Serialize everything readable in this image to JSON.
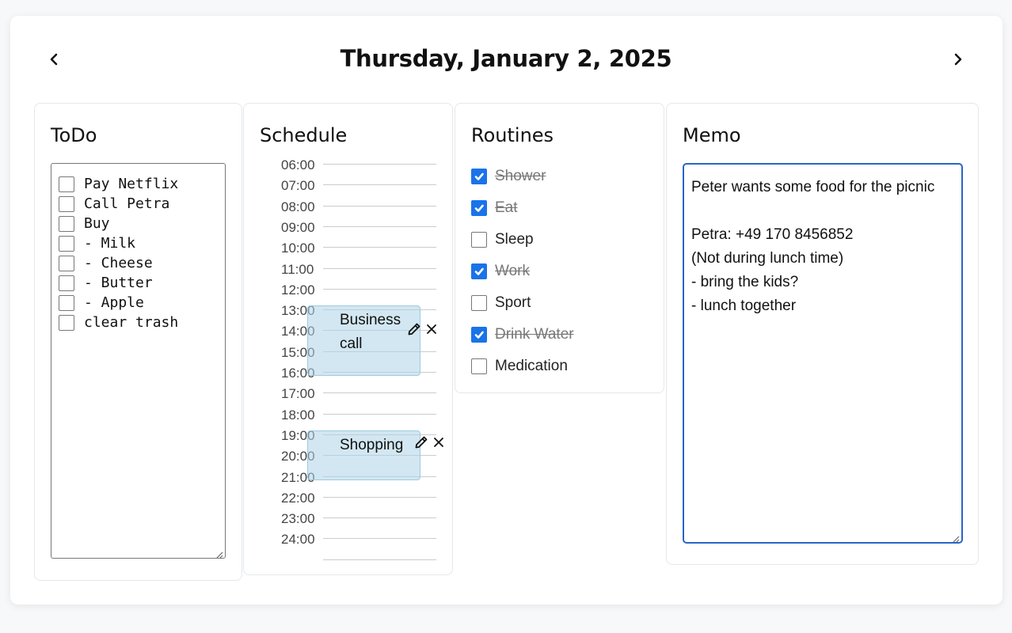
{
  "header": {
    "date": "Thursday, January 2, 2025",
    "prev_icon": "chevron-left-icon",
    "next_icon": "chevron-right-icon"
  },
  "todo": {
    "title": "ToDo",
    "items": [
      {
        "text": "Pay Netflix",
        "checked": false
      },
      {
        "text": "Call Petra",
        "checked": false
      },
      {
        "text": "Buy",
        "checked": false
      },
      {
        "text": "- Milk",
        "checked": false
      },
      {
        "text": "- Cheese",
        "checked": false
      },
      {
        "text": "- Butter",
        "checked": false
      },
      {
        "text": "- Apple",
        "checked": false
      },
      {
        "text": "clear trash",
        "checked": false
      }
    ]
  },
  "schedule": {
    "title": "Schedule",
    "times": [
      "06:00",
      "07:00",
      "08:00",
      "09:00",
      "10:00",
      "11:00",
      "12:00",
      "13:00",
      "14:00",
      "15:00",
      "16:00",
      "17:00",
      "18:00",
      "19:00",
      "20:00",
      "21:00",
      "22:00",
      "23:00",
      "24:00"
    ],
    "events": [
      {
        "title": "Business call",
        "title_line1": "Business",
        "title_line2": "call",
        "start": "13:00",
        "end": "16:30",
        "edit_icon": "pencil-icon",
        "delete_icon": "close-icon"
      },
      {
        "title": "Shopping",
        "start": "19:00",
        "end": "21:30",
        "edit_icon": "pencil-icon",
        "delete_icon": "close-icon"
      }
    ]
  },
  "routines": {
    "title": "Routines",
    "items": [
      {
        "text": "Shower",
        "checked": true
      },
      {
        "text": "Eat",
        "checked": true
      },
      {
        "text": "Sleep",
        "checked": false
      },
      {
        "text": "Work",
        "checked": true
      },
      {
        "text": "Sport",
        "checked": false
      },
      {
        "text": "Drink Water",
        "checked": true
      },
      {
        "text": "Medication",
        "checked": false
      }
    ]
  },
  "memo": {
    "title": "Memo",
    "content": "Peter wants some food for the picnic\n\nPetra: +49 170 8456852\n(Not during lunch time)\n- bring the kids?\n- lunch together"
  },
  "colors": {
    "accent": "#1a73e8",
    "memo_border": "#2a64c9",
    "event_bg": "#d4e9f2"
  }
}
